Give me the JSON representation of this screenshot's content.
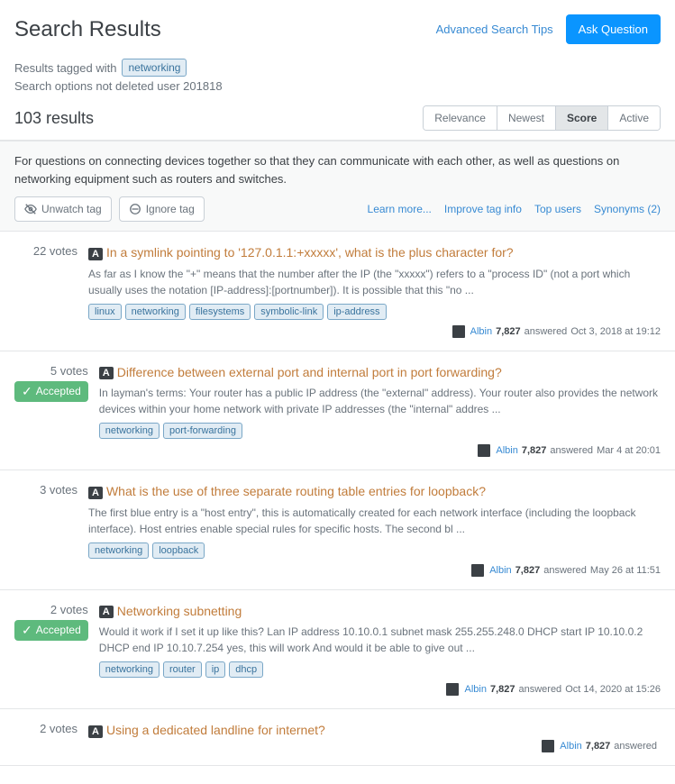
{
  "header": {
    "title": "Search Results",
    "advanced_link": "Advanced Search Tips",
    "ask_button": "Ask Question"
  },
  "sub_header": {
    "results_tagged_label": "Results tagged with",
    "tag": "networking",
    "search_options": "Search options not deleted user 201818"
  },
  "results_bar": {
    "count": "103 results",
    "sort_options": [
      "Relevance",
      "Newest",
      "Score",
      "Active"
    ],
    "active_sort": "Score"
  },
  "tag_info": {
    "description": "For questions on connecting devices together so that they can communicate with each other, as well as questions on networking equipment such as routers and switches.",
    "unwatch_btn": "Unwatch tag",
    "ignore_btn": "Ignore tag",
    "learn_more": "Learn more...",
    "improve_tag": "Improve tag info",
    "top_users": "Top users",
    "synonyms": "Synonyms (2)"
  },
  "questions": [
    {
      "votes": "22 votes",
      "accepted": false,
      "title": "In a symlink pointing to '127.0.1.1:+xxxxx', what is the plus character for?",
      "excerpt": "As far as I know the \"+\" means that the number after the IP (the \"xxxxx\") refers to a \"process ID\" (not a port which usually uses the notation [IP-address]:[portnumber]). It is possible that this \"no ...",
      "tags": [
        "linux",
        "networking",
        "filesystems",
        "symbolic-link",
        "ip-address"
      ],
      "user": "Albin",
      "rep": "7,827",
      "action": "answered",
      "date": "Oct 3, 2018 at 19:12"
    },
    {
      "votes": "5 votes",
      "accepted": true,
      "title": "Difference between external port and internal port in port forwarding?",
      "excerpt": "In layman's terms: Your router has a public IP address (the \"external\" address). Your router also provides the network devices within your home network with private IP addresses (the \"internal\" addres ...",
      "tags": [
        "networking",
        "port-forwarding"
      ],
      "user": "Albin",
      "rep": "7,827",
      "action": "answered",
      "date": "Mar 4 at 20:01"
    },
    {
      "votes": "3 votes",
      "accepted": false,
      "title": "What is the use of three separate routing table entries for loopback?",
      "excerpt": "The first blue entry is a \"host entry\", this is automatically created for each network interface (including the loopback interface). Host entries enable special rules for specific hosts. The second bl ...",
      "tags": [
        "networking",
        "loopback"
      ],
      "user": "Albin",
      "rep": "7,827",
      "action": "answered",
      "date": "May 26 at 11:51"
    },
    {
      "votes": "2 votes",
      "accepted": true,
      "title": "Networking subnetting",
      "excerpt": "Would it work if I set it up like this? Lan IP address 10.10.0.1 subnet mask 255.255.248.0 DHCP start IP 10.10.0.2 DHCP end IP 10.10.7.254 yes, this will work And would it be able to give out ...",
      "tags": [
        "networking",
        "router",
        "ip",
        "dhcp"
      ],
      "user": "Albin",
      "rep": "7,827",
      "action": "answered",
      "date": "Oct 14, 2020 at 15:26"
    },
    {
      "votes": "2 votes",
      "accepted": false,
      "title": "Using a dedicated landline for internet?",
      "excerpt": "",
      "tags": [],
      "user": "Albin",
      "rep": "7,827",
      "action": "answered",
      "date": ""
    }
  ]
}
